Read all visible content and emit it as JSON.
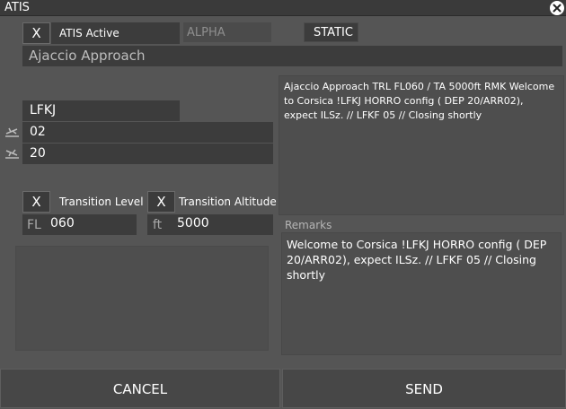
{
  "window": {
    "title": "ATIS",
    "close_icon": "close-icon"
  },
  "atis_active": {
    "checkbox": "X",
    "label": "ATIS Active"
  },
  "letter": "ALPHA",
  "mode": "STATIC",
  "station_name": "Ajaccio Approach",
  "airport": "LFKJ",
  "runways": [
    {
      "icon": "departure-runway-icon",
      "value": "02"
    },
    {
      "icon": "arrival-runway-icon",
      "value": "20"
    }
  ],
  "transition_level": {
    "checkbox": "X",
    "label": "Transition Level",
    "unit": "FL",
    "value": "060"
  },
  "transition_altitude": {
    "checkbox": "X",
    "label": "Transition Altitude",
    "unit": "ft",
    "value": "5000"
  },
  "preview_text": "Ajaccio Approach TRL FL060 / TA 5000ft RMK Welcome to Corsica !LFKJ HORRO config ( DEP 20/ARR02), expect ILSz. // LFKF 05 // Closing shortly",
  "remarks": {
    "label": "Remarks",
    "text": "Welcome to Corsica !LFKJ HORRO config ( DEP 20/ARR02), expect ILSz. // LFKF 05 // Closing shortly"
  },
  "buttons": {
    "cancel": "CANCEL",
    "send": "SEND"
  },
  "colors": {
    "background": "#555555",
    "field": "#3c3c3c",
    "text": "#ffffff",
    "muted": "#a8a8a8"
  }
}
